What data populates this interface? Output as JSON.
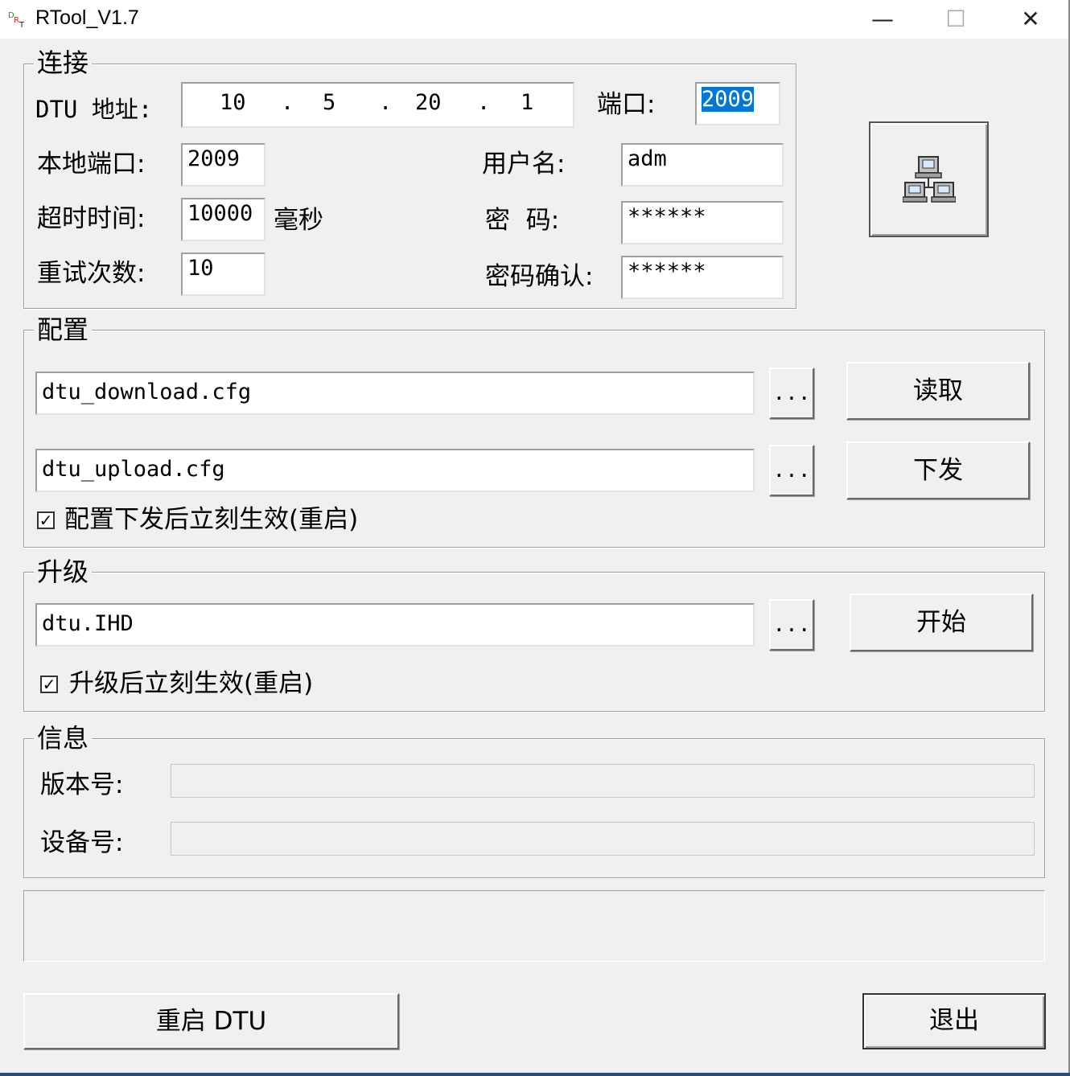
{
  "window": {
    "title": "RTool_V1.7",
    "minimize": "—",
    "maximize": "☐",
    "close": "✕"
  },
  "connect": {
    "legend": "连接",
    "dtu_addr_label": "DTU 地址:",
    "ip": [
      "10",
      "5",
      "20",
      "1"
    ],
    "port_label": "端口:",
    "port_value": "2009",
    "local_port_label": "本地端口:",
    "local_port_value": "2009",
    "username_label": "用户名:",
    "username_value": "adm",
    "timeout_label": "超时时间:",
    "timeout_value": "10000",
    "timeout_unit": "毫秒",
    "password_label": "密  码:",
    "password_value": "******",
    "retry_label": "重试次数:",
    "retry_value": "10",
    "confirm_label": "密码确认:",
    "confirm_value": "******"
  },
  "config": {
    "legend": "配置",
    "download_file": "dtu_download.cfg",
    "upload_file": "dtu_upload.cfg",
    "browse_label": "...",
    "read_button": "读取",
    "send_button": "下发",
    "apply_checkbox_label": "配置下发后立刻生效(重启)",
    "apply_checked": true
  },
  "upgrade": {
    "legend": "升级",
    "file": "dtu.IHD",
    "browse_label": "...",
    "start_button": "开始",
    "apply_checkbox_label": "升级后立刻生效(重启)",
    "apply_checked": true
  },
  "info": {
    "legend": "信息",
    "version_label": "版本号:",
    "version_value": "",
    "device_label": "设备号:",
    "device_value": ""
  },
  "footer": {
    "reboot_button": "重启 DTU",
    "exit_button": "退出"
  },
  "colors": {
    "background": "#f0f0f0",
    "selection": "#0078d7"
  }
}
